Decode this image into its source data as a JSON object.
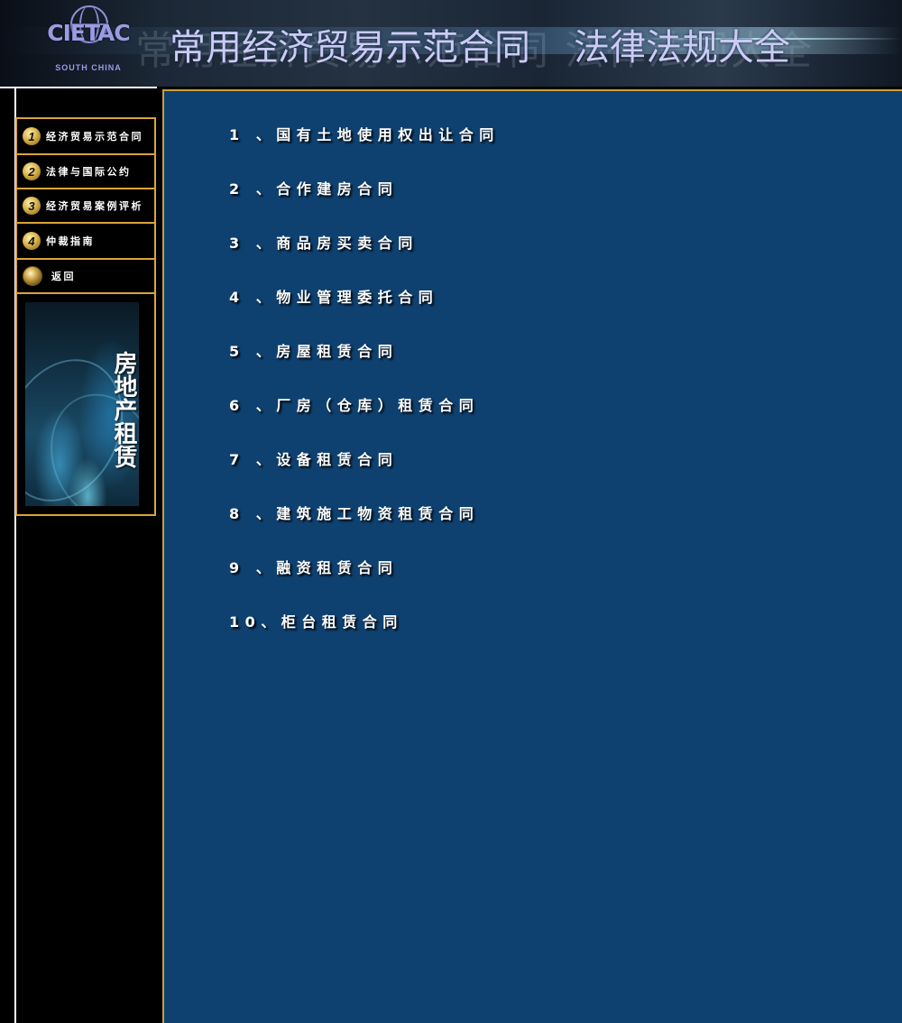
{
  "header": {
    "logo_text": "CIETAC",
    "logo_sub": "SOUTH CHINA",
    "title_left": "常用经济贸易示范合同",
    "title_right": "法律法规大全",
    "ghost_text": "常用经济贸易示范合同 法律法规大全"
  },
  "nav": {
    "items": [
      {
        "badge": "1",
        "label": "经济贸易示范合同"
      },
      {
        "badge": "2",
        "label": "法律与国际公约"
      },
      {
        "badge": "3",
        "label": "经济贸易案例评析"
      },
      {
        "badge": "4",
        "label": "仲裁指南"
      },
      {
        "badge": "",
        "label": "返回"
      }
    ],
    "side_caption": "房地产租赁"
  },
  "contracts": [
    "1 、国有土地使用权出让合同",
    "2 、合作建房合同",
    "3 、商品房买卖合同",
    "4 、物业管理委托合同",
    "5 、房屋租赁合同",
    "6 、厂房（仓库）租赁合同",
    "7 、设备租赁合同",
    "8 、建筑施工物资租赁合同",
    "9 、融资租赁合同",
    "10、柜台租赁合同"
  ],
  "colors": {
    "main_bg": "#0f4170",
    "border_gold": "#d9a53a",
    "title_color": "#c9ccf4"
  }
}
